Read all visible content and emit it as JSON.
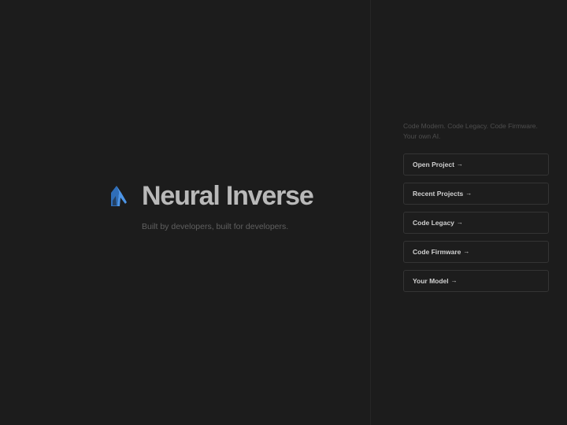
{
  "brand": {
    "name": "Neural Inverse",
    "tagline": "Built by developers, built for developers.",
    "logo_icon": "neural-inverse-logo-icon",
    "accent_color": "#3f86d8"
  },
  "intro": {
    "line1": "Code Modern. Code Legacy. Code Firmware.",
    "line2": "Your own AI."
  },
  "actions": [
    {
      "label": "Open Project",
      "arrow": "→"
    },
    {
      "label": "Recent Projects",
      "arrow": "→"
    },
    {
      "label": "Code Legacy",
      "arrow": "→"
    },
    {
      "label": "Code Firmware",
      "arrow": "→"
    },
    {
      "label": "Your Model",
      "arrow": "→"
    }
  ],
  "colors": {
    "background": "#1c1c1c",
    "button_border": "#343434",
    "title_text": "#b9b9b9",
    "secondary_text": "#606060"
  }
}
